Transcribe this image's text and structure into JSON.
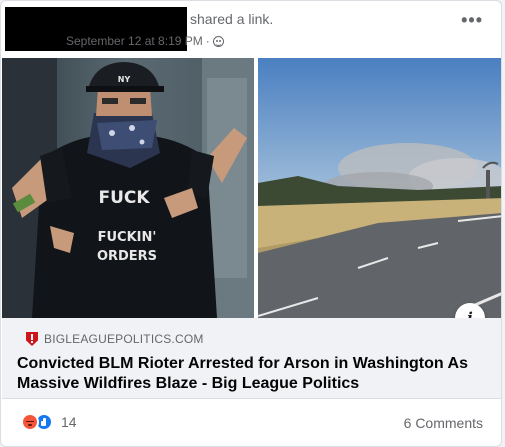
{
  "post": {
    "header": {
      "shared_text": "shared a link.",
      "timestamp": "September 12 at 8:19 PM",
      "separator": "·",
      "audience_icon": "globe-icon",
      "more_icon": "more-options-icon",
      "more_label": "•••"
    },
    "images": [
      {
        "name": "masked-man-photo",
        "shirt_lines": [
          "FUCK",
          "FUCKIN'",
          "ORDERS"
        ]
      },
      {
        "name": "wildfire-road-photo"
      }
    ],
    "info_button_label": "i",
    "link": {
      "domain": "BIGLEAGUEPOLITICS.COM",
      "domain_icon": "shield-alert-icon",
      "title": "Convicted BLM Rioter Arrested for Arson in Washington As Massive Wildfires Blaze - Big League Politics"
    },
    "footer": {
      "reaction_icons": [
        "angry-reaction-icon",
        "like-reaction-icon"
      ],
      "reaction_count": "14",
      "comments": "6 Comments"
    },
    "colors": {
      "like_blue": "#1877f2",
      "angry_orange": "#f5553a",
      "alert_red": "#d0141c",
      "secondary_text": "#65676b"
    }
  }
}
